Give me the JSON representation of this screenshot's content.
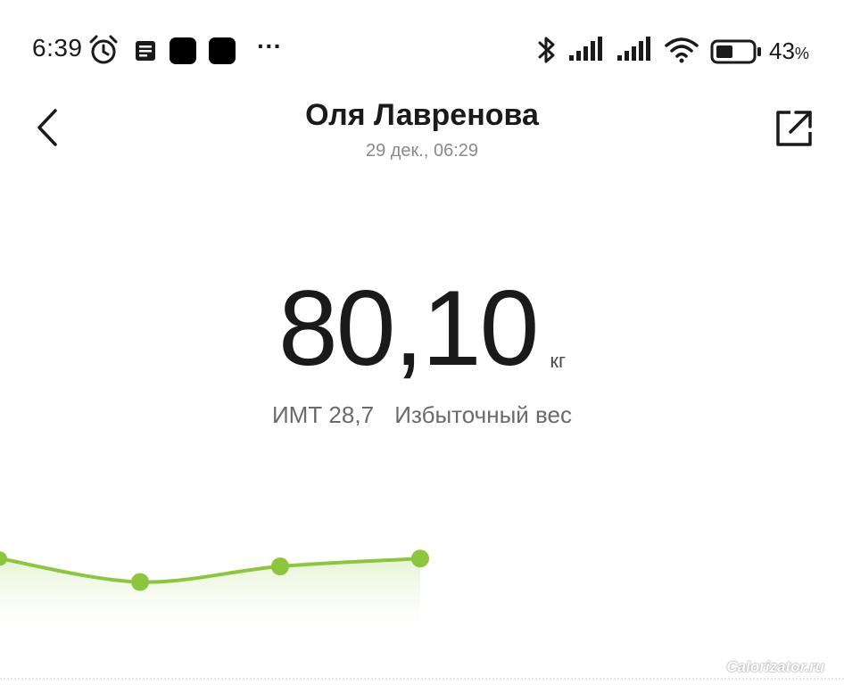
{
  "status_bar": {
    "time": "6:39",
    "more_indicator": "···",
    "battery_percent": "43",
    "battery_suffix": "%",
    "icons": [
      "alarm-icon",
      "notes-icon",
      "app-square-icon",
      "app-square-icon",
      "bluetooth-icon",
      "signal-icon",
      "signal-icon",
      "wifi-icon",
      "battery-icon"
    ]
  },
  "header": {
    "title": "Оля Лавренова",
    "subtitle": "29 дек., 06:29",
    "back_icon": "chevron-left-icon",
    "share_icon": "share-external-icon"
  },
  "measurement": {
    "weight": "80,10",
    "unit": "кг",
    "bmi_label": "ИМТ 28,7",
    "bmi_status": "Избыточный вес"
  },
  "chart_data": {
    "type": "area",
    "series": [
      {
        "values": [
          80.3,
          80.0,
          80.2,
          80.3
        ]
      }
    ],
    "color": "#8cc63f",
    "fill": "#eef7e3"
  },
  "watermark": "Calorizator.ru",
  "colors": {
    "accent": "#8cc63f",
    "text_primary": "#1a1a1a",
    "text_secondary": "#8a8a8a"
  }
}
